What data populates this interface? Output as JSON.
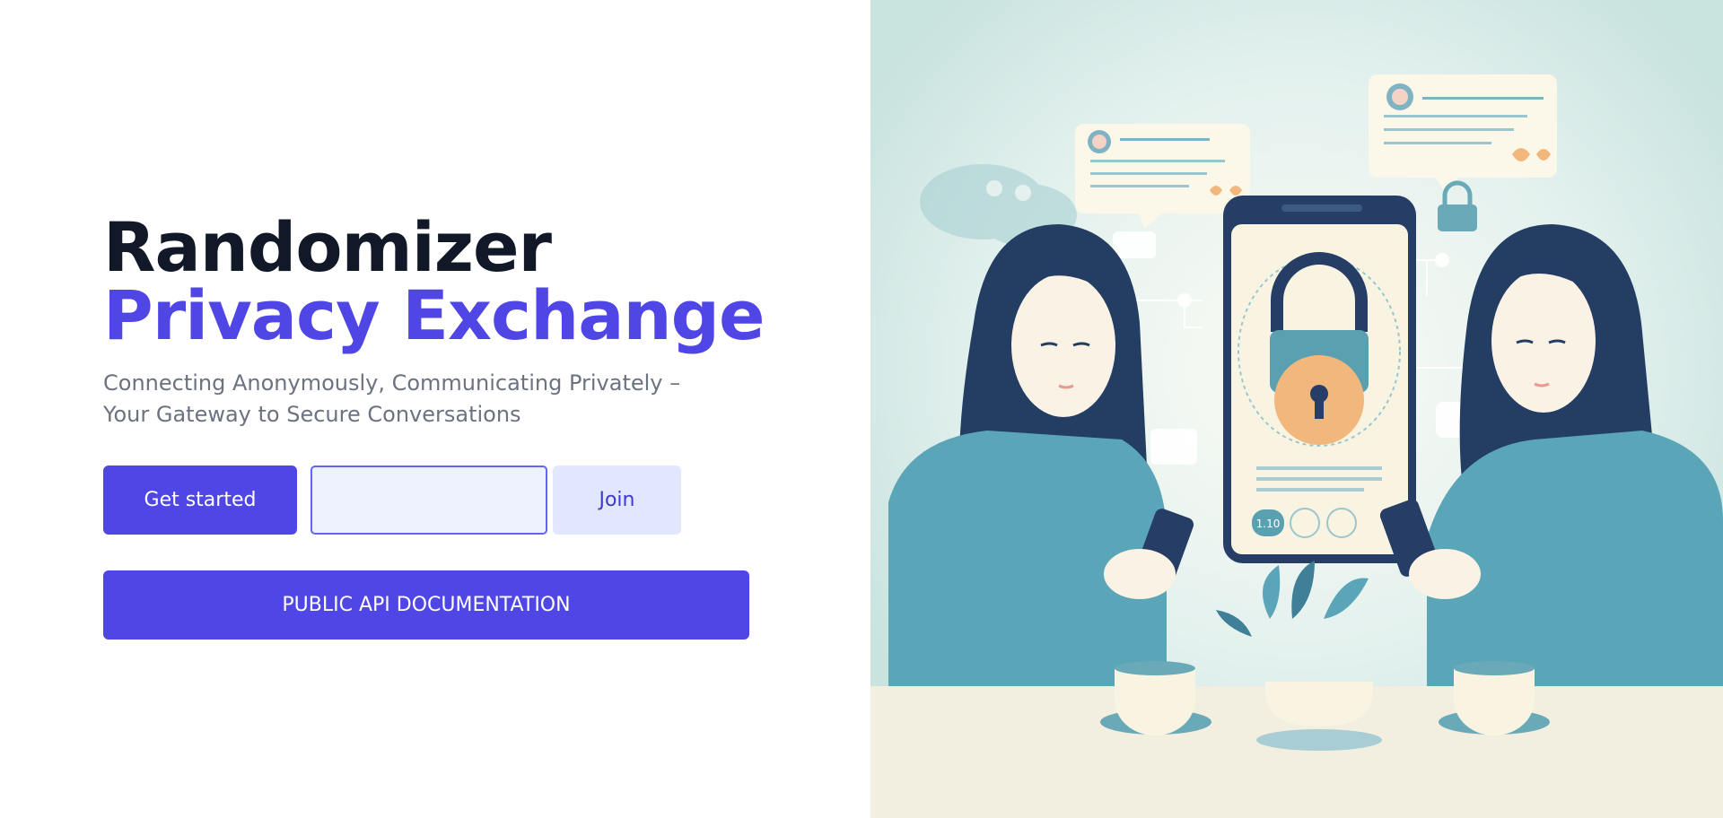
{
  "hero": {
    "title_line1": "Randomizer",
    "title_line2": "Privacy Exchange",
    "subtitle": "Connecting Anonymously, Communicating Privately – Your Gateway to Secure Conversations"
  },
  "actions": {
    "get_started_label": "Get started",
    "join_code_value": "",
    "join_code_placeholder": "",
    "join_label": "Join",
    "docs_label": "PUBLIC API DOCUMENTATION"
  },
  "illustration": {
    "phone_badge": "1.10",
    "colors": {
      "bg": "#cfe7e3",
      "hair": "#233d63",
      "sweater": "#5aa6b8",
      "lock": "#5aa0b0",
      "lock_body": "#f2b77c",
      "accent": "#4f46e5"
    }
  }
}
